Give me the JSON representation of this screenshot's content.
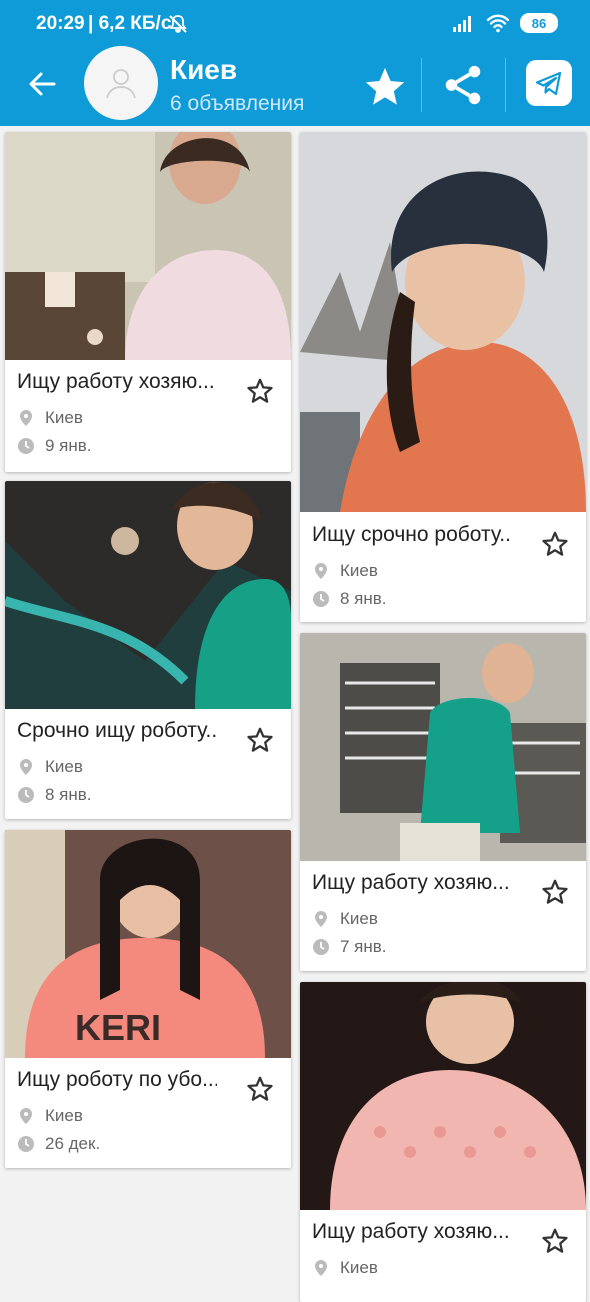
{
  "status_bar": {
    "time": "20:29",
    "network": "| 6,2 КБ/с",
    "battery": "86"
  },
  "toolbar": {
    "title": "Киев",
    "subtitle": "6 объявления",
    "icons": [
      "back-arrow-icon",
      "user-avatar-icon",
      "star-icon",
      "share-icon",
      "telegram-icon"
    ]
  },
  "listings": [
    {
      "title": "Ищу работу хозяю...",
      "location": "Киев",
      "date": "9 янв."
    },
    {
      "title": "Ищу срочно роботу...",
      "location": "Киев",
      "date": "8 янв."
    },
    {
      "title": "Срочно ищу роботу...",
      "location": "Киев",
      "date": "8 янв."
    },
    {
      "title": "Ищу работу хозяю...",
      "location": "Киев",
      "date": "7 янв."
    },
    {
      "title": "Ищу роботу по убо...",
      "location": "Киев",
      "date": "26 дек."
    },
    {
      "title": "Ищу работу хозяю...",
      "location": "Киев",
      "date": ""
    }
  ],
  "colors": {
    "primary": "#0f9bd7",
    "background": "#f2f2f2",
    "card": "#ffffff"
  }
}
